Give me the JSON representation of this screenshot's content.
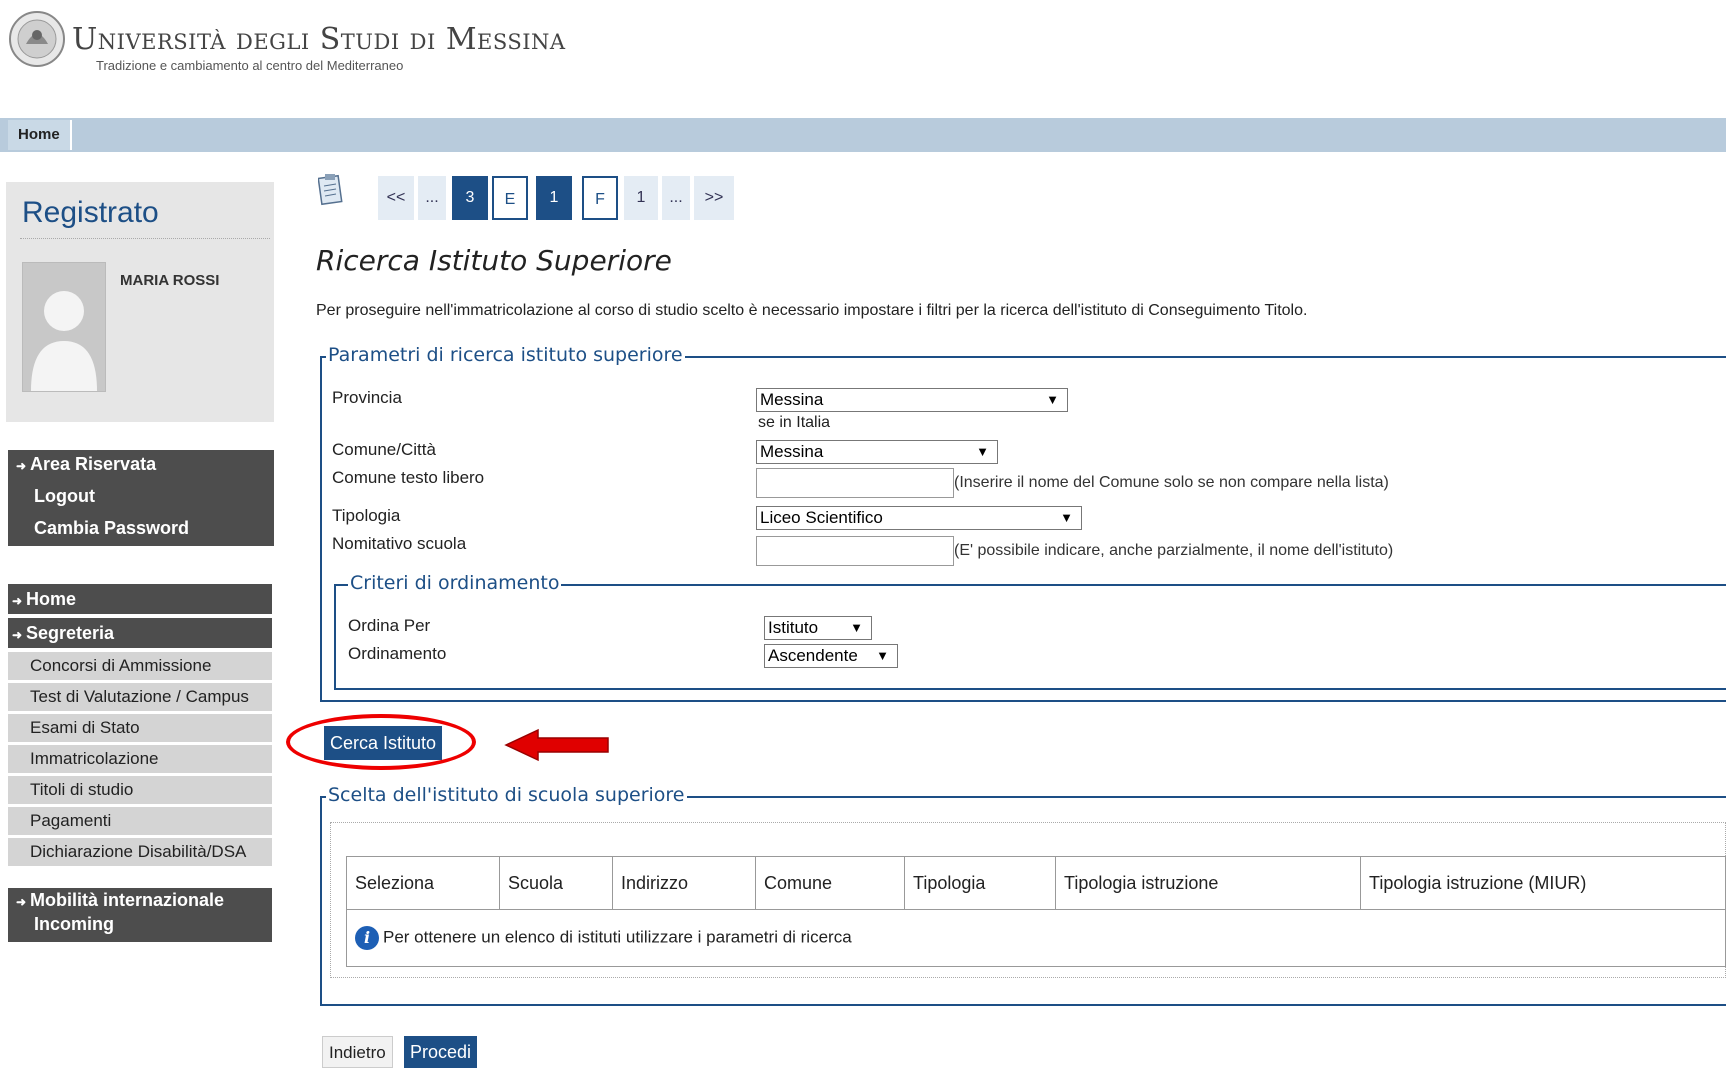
{
  "header": {
    "university_name": "Università degli Studi di Messina",
    "tagline": "Tradizione e cambiamento al centro del Mediterraneo"
  },
  "topbar": {
    "home_label": "Home"
  },
  "sidebar": {
    "heading": "Registrato",
    "user_name": "MARIA ROSSI",
    "area_items": [
      {
        "label": "Area Riservata",
        "arrow": true
      },
      {
        "label": "Logout",
        "arrow": false
      },
      {
        "label": "Cambia Password",
        "arrow": false
      }
    ],
    "nav": {
      "home": "Home",
      "segreteria": "Segreteria",
      "segreteria_items": [
        "Concorsi di Ammissione",
        "Test di Valutazione / Campus",
        "Esami di Stato",
        "Immatricolazione",
        "Titoli di studio",
        "Pagamenti",
        "Dichiarazione Disabilità/DSA"
      ],
      "mobilita_line1": "Mobilità internazionale",
      "mobilita_line2": "Incoming"
    }
  },
  "pagination": [
    "<<",
    "...",
    "3",
    "E",
    "1",
    "F",
    "1",
    "...",
    ">>"
  ],
  "main": {
    "title": "Ricerca Istituto Superiore",
    "intro": "Per proseguire nell'immatricolazione al corso di studio scelto è necessario impostare i filtri per la ricerca dell'istituto di Conseguimento Titolo.",
    "search_params": {
      "legend": "Parametri di ricerca istituto superiore",
      "provincia_label": "Provincia",
      "provincia_value": "Messina",
      "provincia_note": "se in Italia",
      "comune_label": "Comune/Città",
      "comune_value": "Messina",
      "comune_libero_label": "Comune testo libero",
      "comune_libero_value": "",
      "comune_libero_hint": "(Inserire il nome del Comune solo se non compare nella lista)",
      "tipologia_label": "Tipologia",
      "tipologia_value": "Liceo Scientifico",
      "nominativo_label": "Nomitativo scuola",
      "nominativo_value": "",
      "nominativo_hint": "(E' possibile indicare, anche parzialmente, il nome dell'istituto)"
    },
    "ordering": {
      "legend": "Criteri di ordinamento",
      "ordina_per_label": "Ordina Per",
      "ordina_per_value": "Istituto",
      "ordinamento_label": "Ordinamento",
      "ordinamento_value": "Ascendente"
    },
    "search_button": "Cerca Istituto",
    "results": {
      "legend": "Scelta dell'istituto di scuola superiore",
      "columns": [
        "Seleziona",
        "Scuola",
        "Indirizzo",
        "Comune",
        "Tipologia",
        "Tipologia istruzione",
        "Tipologia istruzione (MIUR)"
      ],
      "empty_message": "Per ottenere un elenco di istituti utilizzare i parametri di ricerca"
    },
    "back_button": "Indietro",
    "next_button": "Procedi"
  },
  "colors": {
    "primary": "#1d4f86",
    "topbar": "#b8cbdc",
    "sidebar_dark": "#4d4d4d",
    "highlight": "#e00000"
  }
}
